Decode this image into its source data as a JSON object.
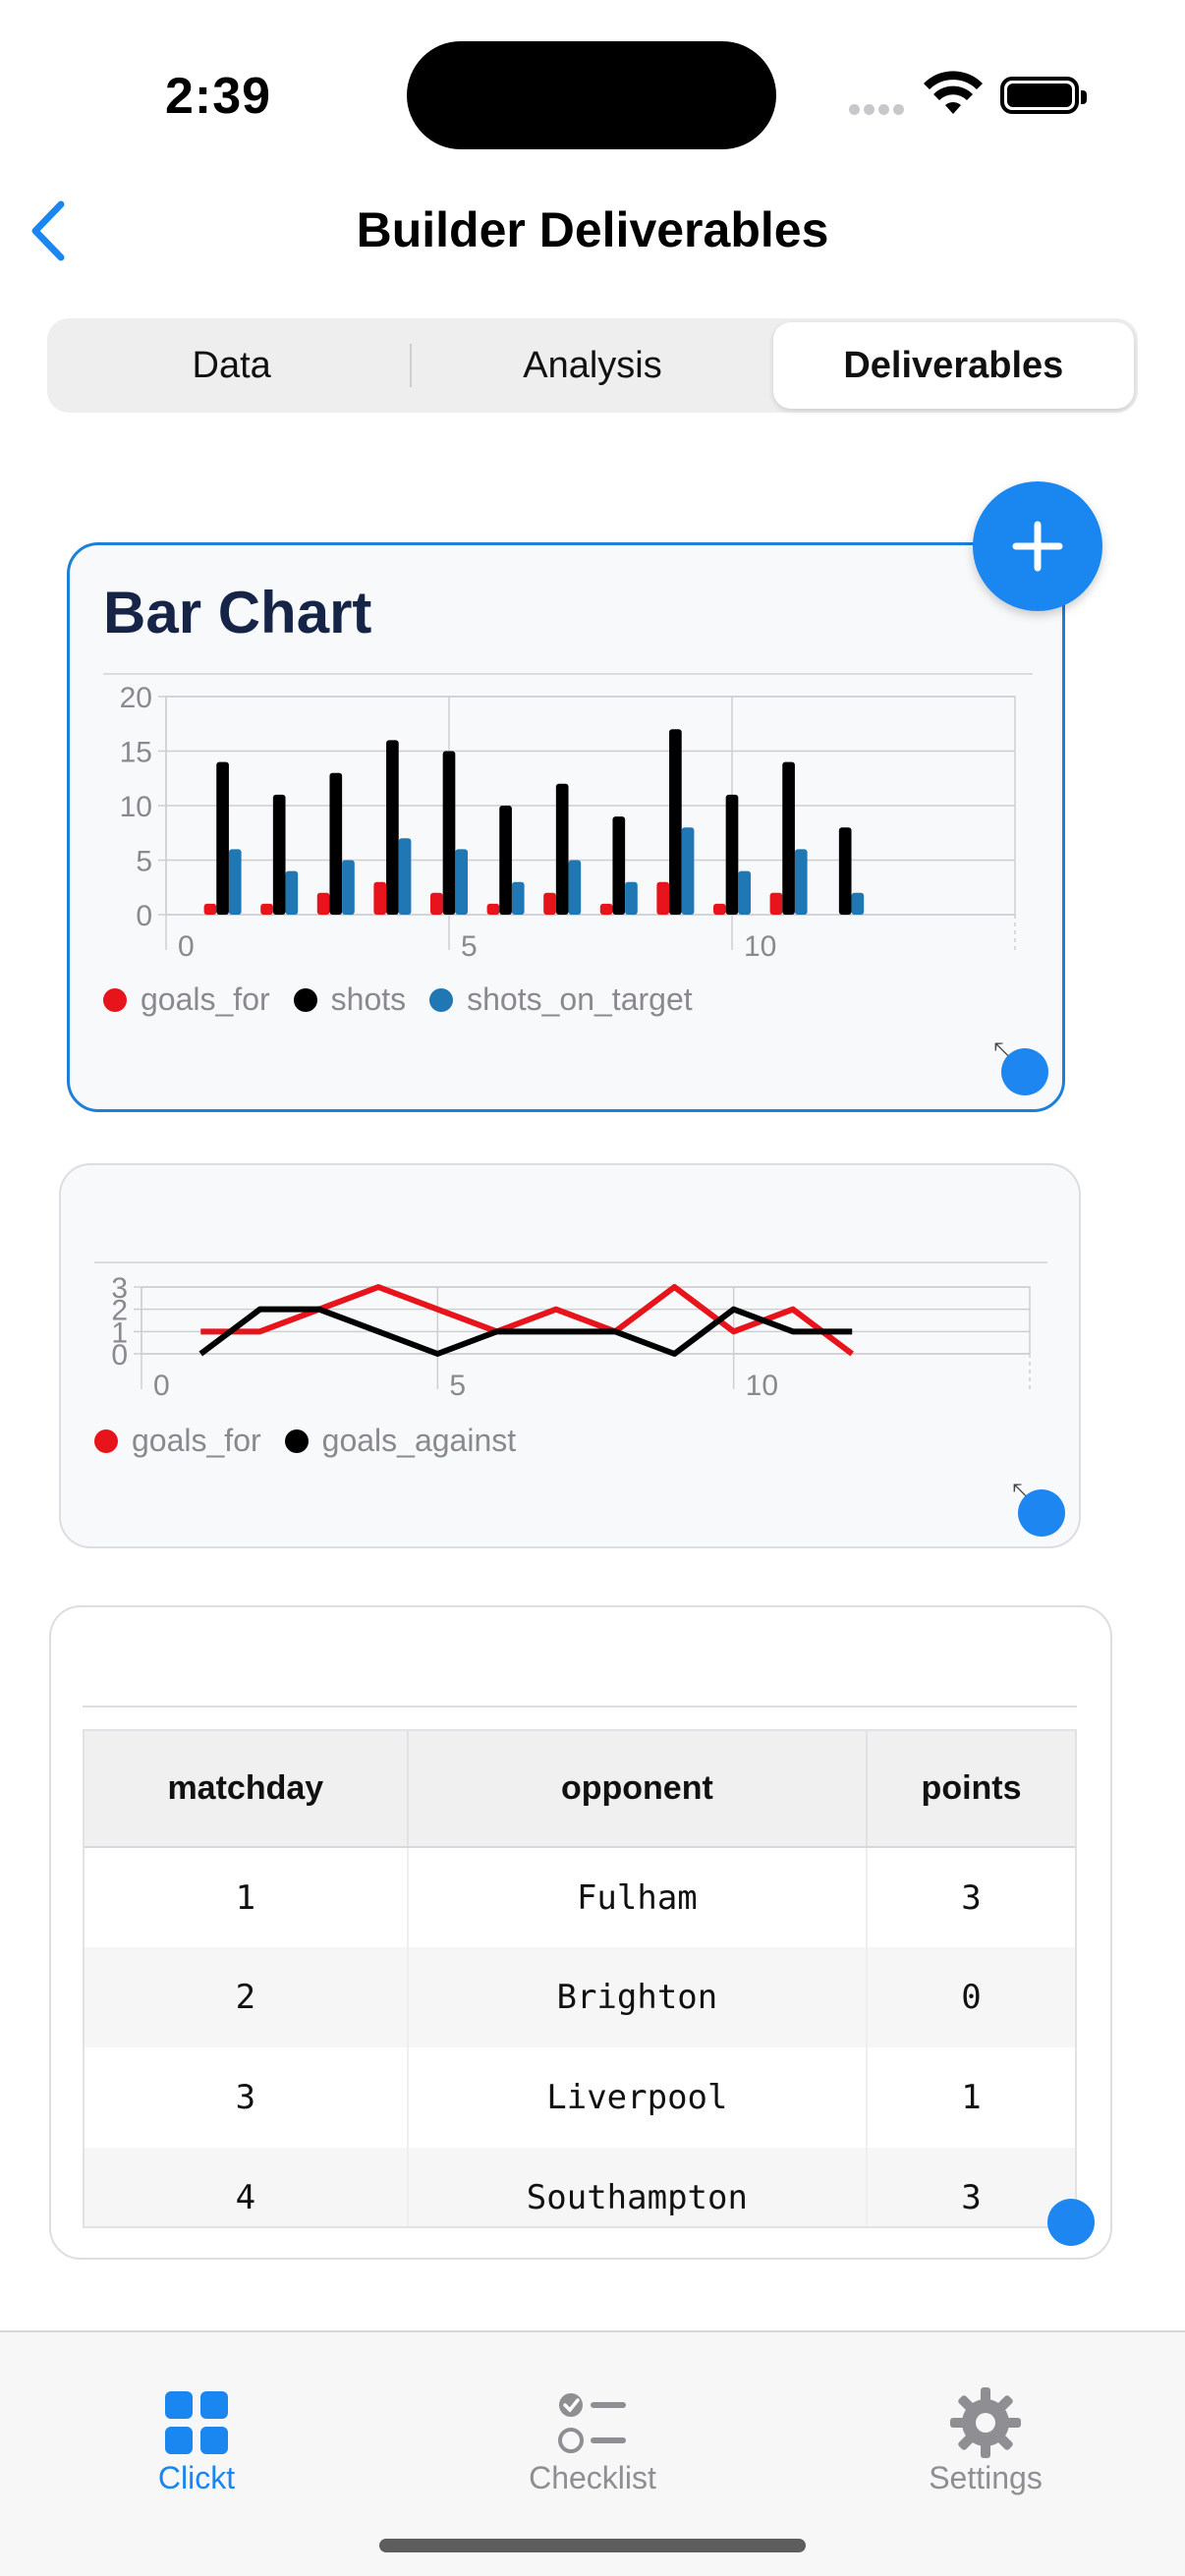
{
  "status_bar": {
    "time": "2:39"
  },
  "nav": {
    "title": "Builder Deliverables"
  },
  "segments": [
    {
      "label": "Data",
      "active": false
    },
    {
      "label": "Analysis",
      "active": false
    },
    {
      "label": "Deliverables",
      "active": true
    }
  ],
  "bar_card": {
    "title": "Bar Chart"
  },
  "line_card": {
    "title": ""
  },
  "chart_data": [
    {
      "type": "bar",
      "title": "Bar Chart",
      "x": [
        1,
        2,
        3,
        4,
        5,
        6,
        7,
        8,
        9,
        10,
        11,
        12
      ],
      "series": [
        {
          "name": "goals_for",
          "color": "#e8141c",
          "values": [
            1,
            1,
            2,
            3,
            2,
            1,
            2,
            1,
            3,
            1,
            2,
            0
          ]
        },
        {
          "name": "shots",
          "color": "#000000",
          "values": [
            14,
            11,
            13,
            16,
            15,
            10,
            12,
            9,
            17,
            11,
            14,
            8
          ]
        },
        {
          "name": "shots_on_target",
          "color": "#1f77b4",
          "values": [
            6,
            4,
            5,
            7,
            6,
            3,
            5,
            3,
            8,
            4,
            6,
            2
          ]
        }
      ],
      "xlim": [
        0,
        15
      ],
      "ylim": [
        0,
        20
      ],
      "x_ticks": [
        "0",
        "5",
        "10"
      ],
      "y_ticks": [
        "0",
        "5",
        "10",
        "15",
        "20"
      ],
      "grid": true,
      "legend": "bottom"
    },
    {
      "type": "line",
      "title": "",
      "x": [
        1,
        2,
        3,
        4,
        5,
        6,
        7,
        8,
        9,
        10,
        11,
        12
      ],
      "series": [
        {
          "name": "goals_for",
          "color": "#e8141c",
          "values": [
            1,
            1,
            2,
            3,
            2,
            1,
            2,
            1,
            3,
            1,
            2,
            0
          ]
        },
        {
          "name": "goals_against",
          "color": "#000000",
          "values": [
            0,
            2,
            2,
            1,
            0,
            1,
            1,
            1,
            0,
            2,
            1,
            1
          ]
        }
      ],
      "xlim": [
        0,
        15
      ],
      "ylim": [
        0,
        3
      ],
      "x_ticks": [
        "0",
        "5",
        "10"
      ],
      "y_ticks": [
        "0",
        "1",
        "2",
        "3"
      ],
      "grid": true,
      "legend": "bottom"
    }
  ],
  "table": {
    "columns": [
      "matchday",
      "opponent",
      "points"
    ],
    "rows": [
      [
        "1",
        "Fulham",
        "3"
      ],
      [
        "2",
        "Brighton",
        "0"
      ],
      [
        "3",
        "Liverpool",
        "1"
      ],
      [
        "4",
        "Southampton",
        "3"
      ]
    ]
  },
  "tabbar": [
    {
      "label": "Clickt",
      "icon": "grid-icon",
      "active": true
    },
    {
      "label": "Checklist",
      "icon": "checklist-icon",
      "active": false
    },
    {
      "label": "Settings",
      "icon": "gear-icon",
      "active": false
    }
  ],
  "colors": {
    "accent": "#1a86f0",
    "title": "#152447"
  }
}
